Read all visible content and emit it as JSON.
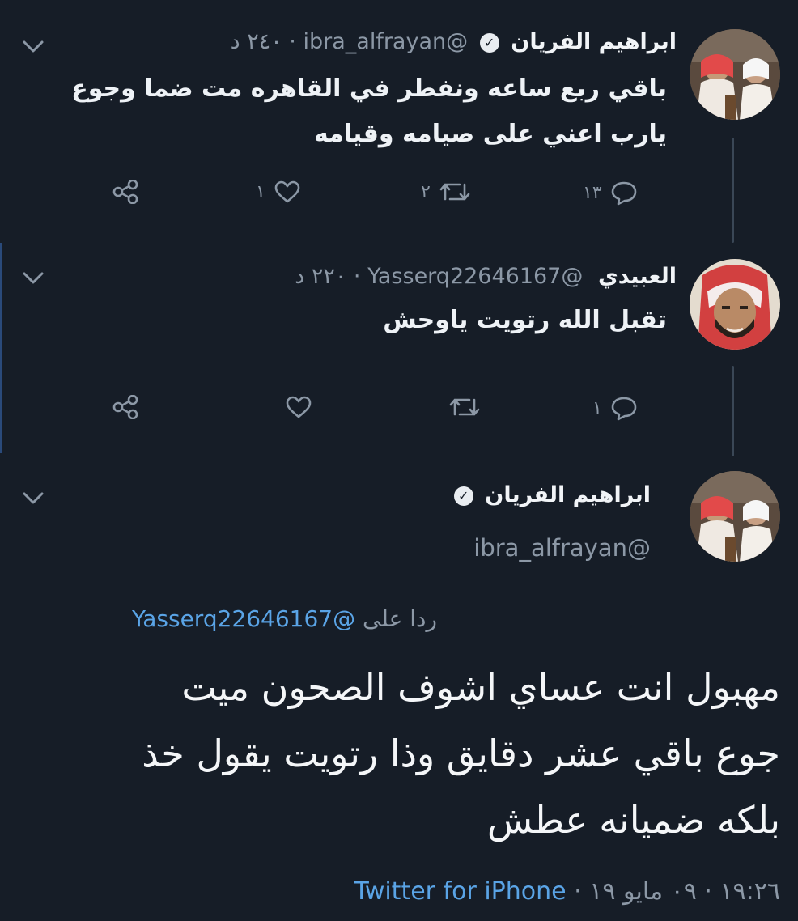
{
  "tweet1": {
    "name": "ابراهيم الفريان",
    "handle": "@ibra_alfrayan",
    "meta": "· ٢٤٠ د",
    "text_lines": [
      "باقي ربع ساعه ونفطر في القاهره مت ضما وجوع",
      "يارب اعني على صيامه وقيامه"
    ],
    "reply_count": "١٣",
    "retweet_count": "٢",
    "like_count": "١"
  },
  "tweet2": {
    "name": "العبيدي",
    "handle": "@Yasserq22646167",
    "meta": "· ٢٢٠ د",
    "text": "تقبل الله رتويت ياوحش",
    "reply_count": "١"
  },
  "tweet3": {
    "name": "ابراهيم الفريان",
    "handle": "@ibra_alfrayan",
    "reply_prefix": "ردا على",
    "reply_mention": "@Yasserq22646167",
    "text_lines": [
      "مهبول انت عساي اشوف الصحون ميت",
      "جوع  باقي عشر دقايق وذا رتويت يقول خذ",
      "بلكه ضميانه عطش"
    ],
    "timestamp": "١٩:٢٦ · ٠٩ مايو ١٩ ·",
    "source": "Twitter for iPhone"
  },
  "icons": [
    "chevron-down-icon",
    "verified-badge-icon",
    "reply-icon",
    "retweet-icon",
    "like-icon",
    "share-icon"
  ]
}
